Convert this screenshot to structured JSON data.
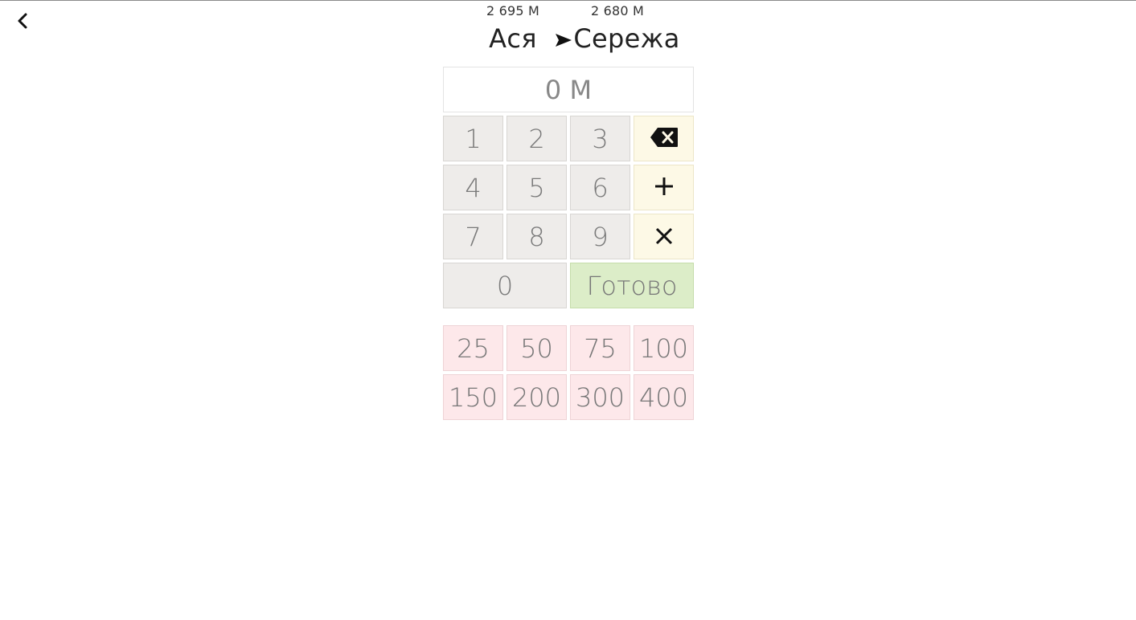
{
  "header": {
    "from": {
      "name": "Ася",
      "balance": "2 695 М"
    },
    "to": {
      "name": "Сережа",
      "balance": "2 680 М"
    }
  },
  "amount": {
    "value": "0 М"
  },
  "keypad": {
    "digits": [
      "1",
      "2",
      "3",
      "4",
      "5",
      "6",
      "7",
      "8",
      "9",
      "0"
    ],
    "done_label": "Готово",
    "backspace_icon": "backspace-icon",
    "plus_icon": "plus-icon",
    "multiply_icon": "multiply-icon"
  },
  "quick_amounts": [
    "25",
    "50",
    "75",
    "100",
    "150",
    "200",
    "300",
    "400"
  ],
  "colors": {
    "digit_key": "#eeecea",
    "operator_key": "#fdf9e6",
    "done_key": "#dcedc8",
    "quick_key": "#fde8ea"
  }
}
